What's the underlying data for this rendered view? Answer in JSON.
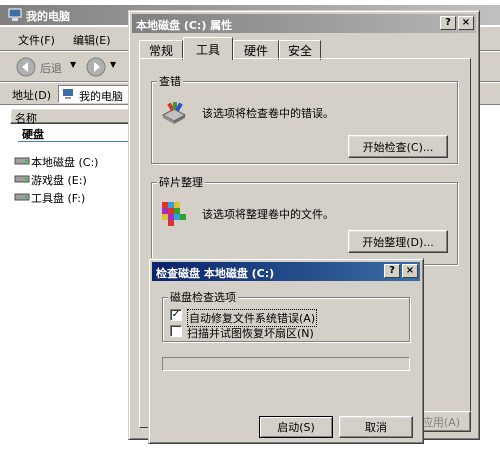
{
  "explorer": {
    "title": "我的电脑",
    "menu": [
      "文件(F)",
      "编辑(E)"
    ],
    "back_label": "后退",
    "address_label": "地址(D)",
    "address_value": "我的电脑",
    "column_name": "名称",
    "group_harddisk": "硬盘",
    "drives": [
      "本地磁盘 (C:)",
      "游戏盘 (E:)",
      "工具盘 (F:)"
    ]
  },
  "props": {
    "title": "本地磁盘 (C:) 属性",
    "help_btn": "?",
    "close_btn": "×",
    "tabs": [
      "常规",
      "工具",
      "硬件",
      "安全"
    ],
    "active_tab": "工具",
    "error_check": {
      "title": "查错",
      "desc": "该选项将检查卷中的错误。",
      "button": "开始检查(C)..."
    },
    "defrag": {
      "title": "碎片整理",
      "desc": "该选项将整理卷中的文件。",
      "button": "开始整理(D)..."
    },
    "apply_button": "应用(A)"
  },
  "check_dialog": {
    "title": "检查磁盘 本地磁盘 (C:)",
    "help_btn": "?",
    "close_btn": "×",
    "group_title": "磁盘检查选项",
    "options": [
      {
        "label": "自动修复文件系统错误(A)",
        "checked": true
      },
      {
        "label": "扫描并试图恢复坏扇区(N)",
        "checked": false
      }
    ],
    "progress": 0,
    "start_button": "启动(S)",
    "cancel_button": "取消"
  }
}
